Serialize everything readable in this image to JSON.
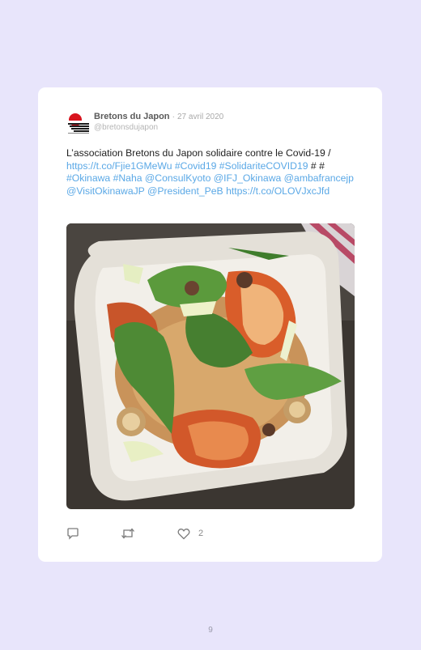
{
  "tweet": {
    "author_name": "Bretons du Japon",
    "separator": "·",
    "date": "27 avril 2020",
    "handle": "@bretonsdujapon",
    "text_segments": [
      {
        "t": "L’association Bretons du Japon solidaire contre le Covid-19 / ",
        "link": false
      },
      {
        "t": "https://t.co/Fjie1GMeWu",
        "link": true
      },
      {
        "t": " ",
        "link": false
      },
      {
        "t": "#Covid19",
        "link": true
      },
      {
        "t": " ",
        "link": false
      },
      {
        "t": "#SolidariteCOVID19",
        "link": true
      },
      {
        "t": " # # ",
        "link": false
      },
      {
        "t": "#Okinawa",
        "link": true
      },
      {
        "t": " ",
        "link": false
      },
      {
        "t": "#Naha",
        "link": true
      },
      {
        "t": " ",
        "link": false
      },
      {
        "t": "@ConsulKyoto",
        "link": true
      },
      {
        "t": " ",
        "link": false
      },
      {
        "t": "@IFJ_Okinawa",
        "link": true
      },
      {
        "t": " ",
        "link": false
      },
      {
        "t": "@ambafrancejp",
        "link": true
      },
      {
        "t": " ",
        "link": false
      },
      {
        "t": "@VisitOkinawaJP",
        "link": true
      },
      {
        "t": " ",
        "link": false
      },
      {
        "t": "@President_PeB",
        "link": true
      },
      {
        "t": " ",
        "link": false
      },
      {
        "t": "https://t.co/OLOVJxcJfd",
        "link": true
      }
    ],
    "like_count": "2"
  },
  "icons": {
    "reply": "reply-icon",
    "retweet": "retweet-icon",
    "like": "heart-icon",
    "avatar": "avatar-logo"
  },
  "colors": {
    "background": "#e8e5fb",
    "link": "#5aa8e6",
    "card": "#ffffff"
  },
  "page_number": "9"
}
